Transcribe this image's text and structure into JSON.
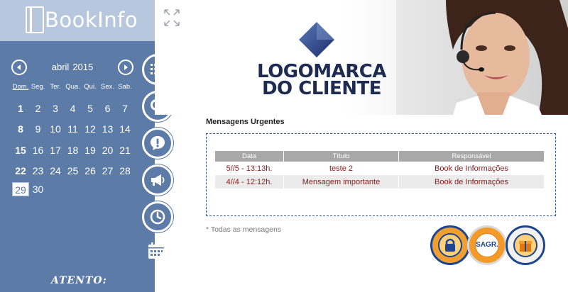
{
  "app": {
    "name": "BookInfo"
  },
  "calendar": {
    "month": "abril",
    "year": "2015",
    "weekdays": [
      "Dom.",
      "Seg.",
      "Ter.",
      "Qua.",
      "Qui.",
      "Sex.",
      "Sab."
    ],
    "weeks": [
      [
        "1",
        "2",
        "3",
        "4",
        "5",
        "6",
        "7"
      ],
      [
        "8",
        "9",
        "10",
        "11",
        "12",
        "13",
        "14"
      ],
      [
        "15",
        "16",
        "17",
        "18",
        "19",
        "20",
        "21"
      ],
      [
        "22",
        "23",
        "24",
        "25",
        "26",
        "27",
        "28"
      ],
      [
        "29",
        "30"
      ]
    ],
    "today": "29"
  },
  "nav": {
    "icons": [
      "list-icon",
      "search-icon",
      "alert-icon",
      "megaphone-icon",
      "clock-icon",
      "calendar-icon"
    ]
  },
  "banner": {
    "client_logo_line1": "LOGOMARCA",
    "client_logo_line2": "DO CLIENTE"
  },
  "messages": {
    "title": "Mensagens Urgentes",
    "columns": [
      "Data",
      "Título",
      "Responsável"
    ],
    "rows": [
      {
        "date": "5//5 - 13:13h.",
        "title": "teste 2",
        "owner": "Book de Informações"
      },
      {
        "date": "4//4 - 12:12h.",
        "title": "Mensagem importante",
        "owner": "Book de Informações"
      }
    ],
    "all_link": "*  Todas as mensagens"
  },
  "badges": {
    "sagr": "SAGR."
  },
  "footer": {
    "atento": "ATENTO:"
  },
  "colors": {
    "sidebar": "#5d7ba7",
    "logo_bar": "#b7c7dd",
    "accent_red": "#8b1a1a",
    "table_header": "#a8a8a8"
  }
}
